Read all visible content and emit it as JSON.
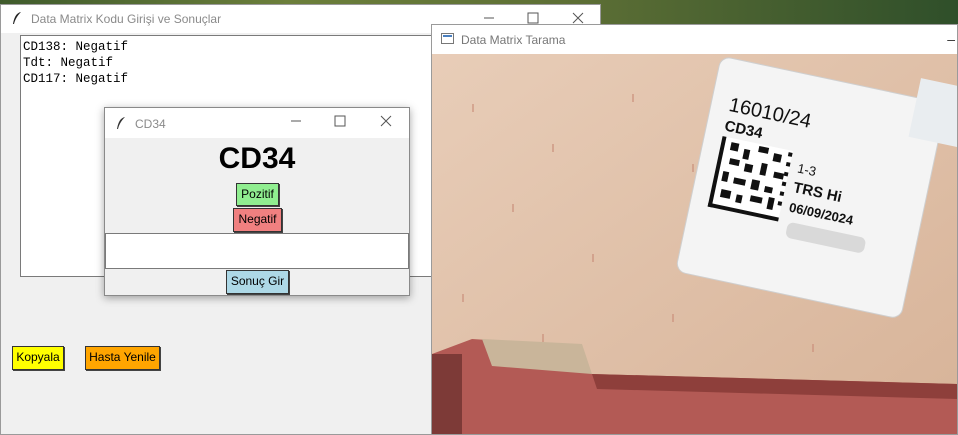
{
  "main_window": {
    "title": "Data Matrix Kodu Girişi ve Sonuçlar",
    "results": [
      "CD138: Negatif",
      "Tdt: Negatif",
      "CD117: Negatif"
    ],
    "buttons": {
      "copy": "Kopyala",
      "renew_patient": "Hasta Yenile"
    }
  },
  "camera_window": {
    "title": "Data Matrix Tarama",
    "label": {
      "number": "16010/24",
      "code": "CD34",
      "line1": "1-3",
      "line2": "TRS Hi",
      "date": "06/09/2024"
    }
  },
  "dialog": {
    "title": "CD34",
    "heading": "CD34",
    "positive_label": "Pozitif",
    "negative_label": "Negatif",
    "input_value": "",
    "submit_label": "Sonuç Gir"
  },
  "colors": {
    "copy_button": "#ffff00",
    "renew_button": "#ffa500",
    "positive_button": "#90ee90",
    "negative_button": "#f08080",
    "submit_button": "#add8e6"
  },
  "icons": [
    "feather-icon",
    "minimize-icon",
    "maximize-icon",
    "close-icon",
    "camera-window-icon"
  ]
}
